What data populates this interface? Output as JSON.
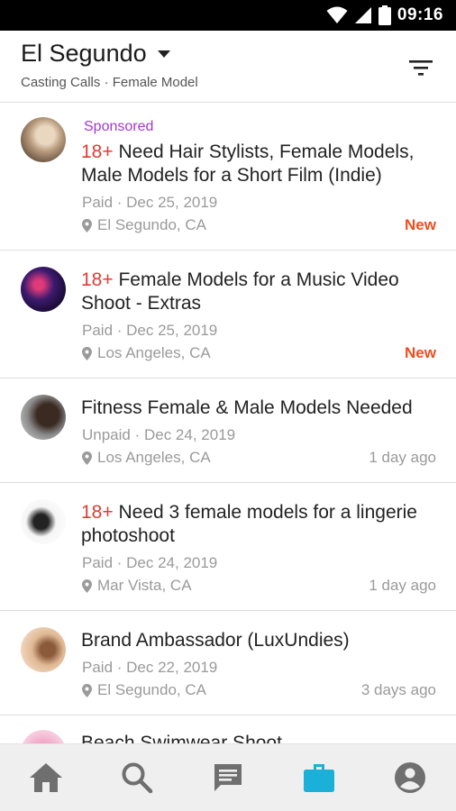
{
  "status_bar": {
    "time": "09:16"
  },
  "header": {
    "location": "El Segundo",
    "subtitle": "Casting Calls · Female Model"
  },
  "listings": [
    {
      "sponsored": "Sponsored",
      "age_tag": "18+",
      "title": "Need Hair Stylists, Female Models, Male Models for a Short Film (Indie)",
      "meta": "Paid · Dec 25, 2019",
      "location": "El Segundo, CA",
      "badge": "New"
    },
    {
      "age_tag": "18+",
      "title": "Female Models for a Music Video Shoot - Extras",
      "meta": "Paid · Dec 25, 2019",
      "location": "Los Angeles, CA",
      "badge": "New"
    },
    {
      "title": "Fitness Female & Male Models Needed",
      "meta": "Unpaid · Dec 24, 2019",
      "location": "Los Angeles, CA",
      "ago": "1 day ago"
    },
    {
      "age_tag": "18+",
      "title": "Need 3 female models for a lingerie photoshoot",
      "meta": "Paid · Dec 24, 2019",
      "location": "Mar Vista, CA",
      "ago": "1 day ago"
    },
    {
      "title": "Brand Ambassador (LuxUndies)",
      "meta": "Paid · Dec 22, 2019",
      "location": "El Segundo, CA",
      "ago": "3 days ago"
    },
    {
      "title": "Beach Swimwear Shoot"
    }
  ],
  "nav": {
    "items": [
      "home-icon",
      "search-icon",
      "messages-icon",
      "jobs-icon",
      "profile-icon"
    ],
    "active_index": 3,
    "active_color": "#1ab0d8",
    "inactive_color": "#6f6f6f"
  },
  "colors": {
    "sponsored": "#a338d1",
    "age_tag": "#e23b33",
    "new_badge": "#f04d1d"
  }
}
